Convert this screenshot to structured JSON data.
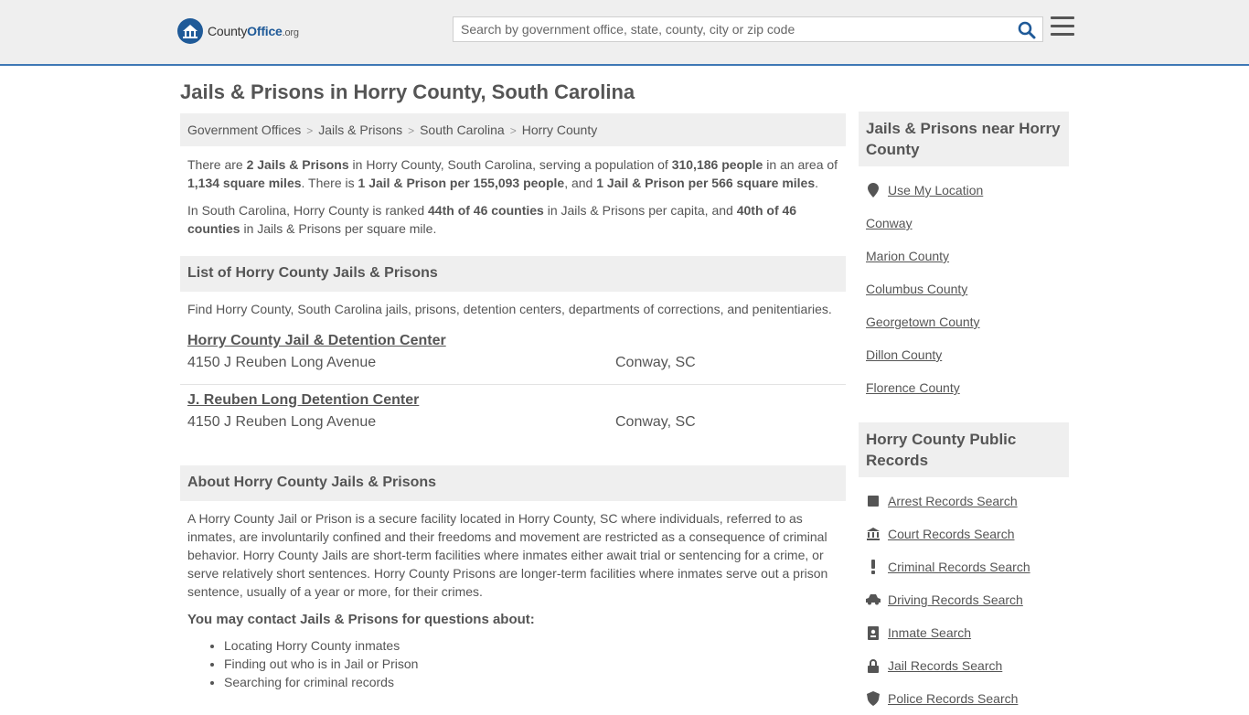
{
  "header": {
    "logo_prefix": "County",
    "logo_brand": "Office",
    "logo_suffix": ".org",
    "search_placeholder": "Search by government office, state, county, city or zip code"
  },
  "page": {
    "title": "Jails & Prisons in Horry County, South Carolina"
  },
  "breadcrumb": [
    "Government Offices",
    "Jails & Prisons",
    "South Carolina",
    "Horry County"
  ],
  "intro": {
    "p1": [
      {
        "t": "There are ",
        "b": false
      },
      {
        "t": "2 Jails & Prisons",
        "b": true
      },
      {
        "t": " in Horry County, South Carolina, serving a population of ",
        "b": false
      },
      {
        "t": "310,186 people",
        "b": true
      },
      {
        "t": " in an area of ",
        "b": false
      },
      {
        "t": "1,134 square miles",
        "b": true
      },
      {
        "t": ". There is ",
        "b": false
      },
      {
        "t": "1 Jail & Prison per 155,093 people",
        "b": true
      },
      {
        "t": ", and ",
        "b": false
      },
      {
        "t": "1 Jail & Prison per 566 square miles",
        "b": true
      },
      {
        "t": ".",
        "b": false
      }
    ],
    "p2": [
      {
        "t": "In South Carolina, Horry County is ranked ",
        "b": false
      },
      {
        "t": "44th of 46 counties",
        "b": true
      },
      {
        "t": " in Jails & Prisons per capita, and ",
        "b": false
      },
      {
        "t": "40th of 46 counties",
        "b": true
      },
      {
        "t": " in Jails & Prisons per square mile.",
        "b": false
      }
    ]
  },
  "list_section": {
    "heading": "List of Horry County Jails & Prisons",
    "description": "Find Horry County, South Carolina jails, prisons, detention centers, departments of corrections, and penitentiaries.",
    "listings": [
      {
        "name": "Horry County Jail & Detention Center",
        "address": "4150 J Reuben Long Avenue",
        "city": "Conway, SC"
      },
      {
        "name": "J. Reuben Long Detention Center",
        "address": "4150 J Reuben Long Avenue",
        "city": "Conway, SC"
      }
    ]
  },
  "about": {
    "heading": "About Horry County Jails & Prisons",
    "paragraph": "A Horry County Jail or Prison is a secure facility located in Horry County, SC where individuals, referred to as inmates, are involuntarily confined and their freedoms and movement are restricted as a consequence of criminal behavior. Horry County Jails are short-term facilities where inmates either await trial or sentencing for a crime, or serve relatively short sentences. Horry County Prisons are longer-term facilities where inmates serve out a prison sentence, usually of a year or more, for their crimes.",
    "contact_heading": "You may contact Jails & Prisons for questions about:",
    "bullets": [
      "Locating Horry County inmates",
      "Finding out who is in Jail or Prison",
      "Searching for criminal records"
    ]
  },
  "sidebar": {
    "nearby_heading": "Jails & Prisons near Horry County",
    "use_location": "Use My Location",
    "nearby": [
      "Conway",
      "Marion County",
      "Columbus County",
      "Georgetown County",
      "Dillon County",
      "Florence County"
    ],
    "records_heading": "Horry County Public Records",
    "records": [
      {
        "label": "Arrest Records Search",
        "icon": "square-icon"
      },
      {
        "label": "Court Records Search",
        "icon": "courthouse-icon"
      },
      {
        "label": "Criminal Records Search",
        "icon": "exclamation-icon"
      },
      {
        "label": "Driving Records Search",
        "icon": "car-icon"
      },
      {
        "label": "Inmate Search",
        "icon": "id-badge-icon"
      },
      {
        "label": "Jail Records Search",
        "icon": "lock-icon"
      },
      {
        "label": "Police Records Search",
        "icon": "shield-icon"
      }
    ]
  }
}
